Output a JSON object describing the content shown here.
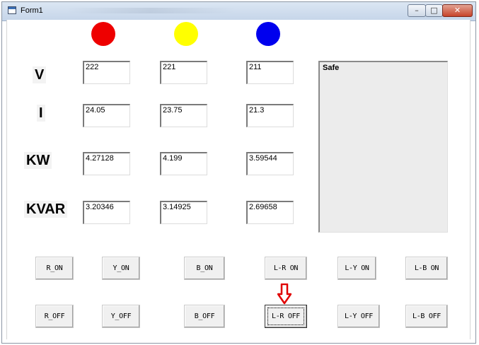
{
  "window": {
    "title": "Form1",
    "controls": {
      "minimize": "–",
      "maximize": "□",
      "close": "✕"
    }
  },
  "indicators": [
    {
      "phase": "R",
      "color": "#ee0000"
    },
    {
      "phase": "Y",
      "color": "#ffff00"
    },
    {
      "phase": "B",
      "color": "#0000ee"
    }
  ],
  "rows": [
    {
      "label": "V",
      "values": [
        "222",
        "221",
        "211"
      ]
    },
    {
      "label": "I",
      "values": [
        "24.05",
        "23.75",
        "21.3"
      ]
    },
    {
      "label": "KW",
      "values": [
        "4.27128",
        "4.199",
        "3.59544"
      ]
    },
    {
      "label": "KVAR",
      "values": [
        "3.20346",
        "3.14925",
        "2.69658"
      ]
    }
  ],
  "status_box": {
    "text": "Safe"
  },
  "buttons": {
    "on": [
      "R_ON",
      "Y_ON",
      "B_ON",
      "L-R ON",
      "L-Y ON",
      "L-B ON"
    ],
    "off": [
      "R_OFF",
      "Y_OFF",
      "B_OFF",
      "L-R OFF",
      "L-Y OFF",
      "L-B OFF"
    ]
  },
  "annotation": {
    "arrow_color": "#e00000",
    "icon": "down-arrow-icon"
  }
}
